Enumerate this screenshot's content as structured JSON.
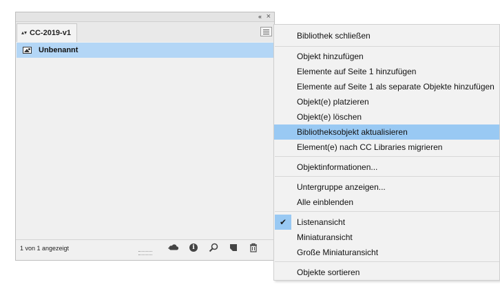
{
  "panel": {
    "tab_label": "CC-2019-v1",
    "tab_arrows": "▴▾",
    "collapse_glyph": "«",
    "close_glyph": "×",
    "items": [
      {
        "label": "Unbenannt",
        "icon": "image-icon",
        "selected": true
      }
    ],
    "status_text": "1 von 1 angezeigt",
    "footer_icons": [
      "cc-libraries-cloud-icon",
      "info-icon",
      "search-icon",
      "new-item-icon",
      "trash-icon"
    ],
    "selection_color": "#b3d6f6"
  },
  "menu": {
    "items": [
      {
        "label": "Bibliothek schließen"
      },
      {
        "label": "Objekt hinzufügen"
      },
      {
        "label": "Elemente auf Seite 1 hinzufügen"
      },
      {
        "label": "Elemente auf Seite 1 als separate Objekte hinzufügen"
      },
      {
        "label": "Objekt(e) platzieren"
      },
      {
        "label": "Objekt(e) löschen"
      },
      {
        "label": "Bibliotheksobjekt aktualisieren",
        "highlighted": true
      },
      {
        "label": "Element(e) nach CC Libraries migrieren"
      },
      {
        "label": "Objektinformationen..."
      },
      {
        "label": "Untergruppe anzeigen..."
      },
      {
        "label": "Alle einblenden"
      },
      {
        "label": "Listenansicht",
        "checked": true
      },
      {
        "label": "Miniaturansicht"
      },
      {
        "label": "Große Miniaturansicht"
      },
      {
        "label": "Objekte sortieren"
      }
    ],
    "check_glyph": "✔",
    "highlight_color": "#99c9f3"
  }
}
